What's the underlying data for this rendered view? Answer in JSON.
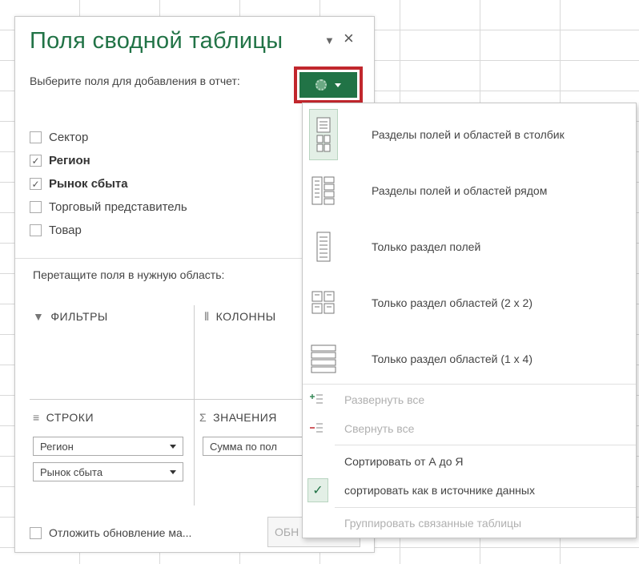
{
  "pane": {
    "title": "Поля сводной таблицы",
    "close_glyph": "×",
    "menu_glyph": "▼",
    "choose_fields": "Выберите поля для добавления в отчет:",
    "fields": [
      {
        "label": "Сектор",
        "checked": false
      },
      {
        "label": "Регион",
        "checked": true
      },
      {
        "label": "Рынок сбыта",
        "checked": true
      },
      {
        "label": "Торговый представитель",
        "checked": false
      },
      {
        "label": "Товар",
        "checked": false
      }
    ],
    "drag_label": "Перетащите поля в нужную область:",
    "areas": {
      "filters": "ФИЛЬТРЫ",
      "columns": "КОЛОННЫ",
      "rows": "СТРОКИ",
      "values": "ЗНАЧЕНИЯ"
    },
    "row_items": [
      "Регион",
      "Рынок сбыта"
    ],
    "value_items": [
      "Сумма по пол"
    ],
    "defer_label": "Отложить обновление ма...",
    "update_button": "ОБН"
  },
  "tools_menu": {
    "layout_options": [
      "Разделы полей и областей в столбик",
      "Разделы полей и областей рядом",
      "Только раздел полей",
      "Только раздел областей (2 x 2)",
      "Только раздел областей (1 x 4)"
    ],
    "expand_all": "Развернуть все",
    "collapse_all": "Свернуть все",
    "sort_az": "Сортировать от А до Я",
    "sort_source": "сортировать как в источнике данных",
    "group_tables": "Группировать связанные таблицы"
  },
  "colors": {
    "accent_green": "#217346",
    "highlight_red": "#c1272d"
  }
}
